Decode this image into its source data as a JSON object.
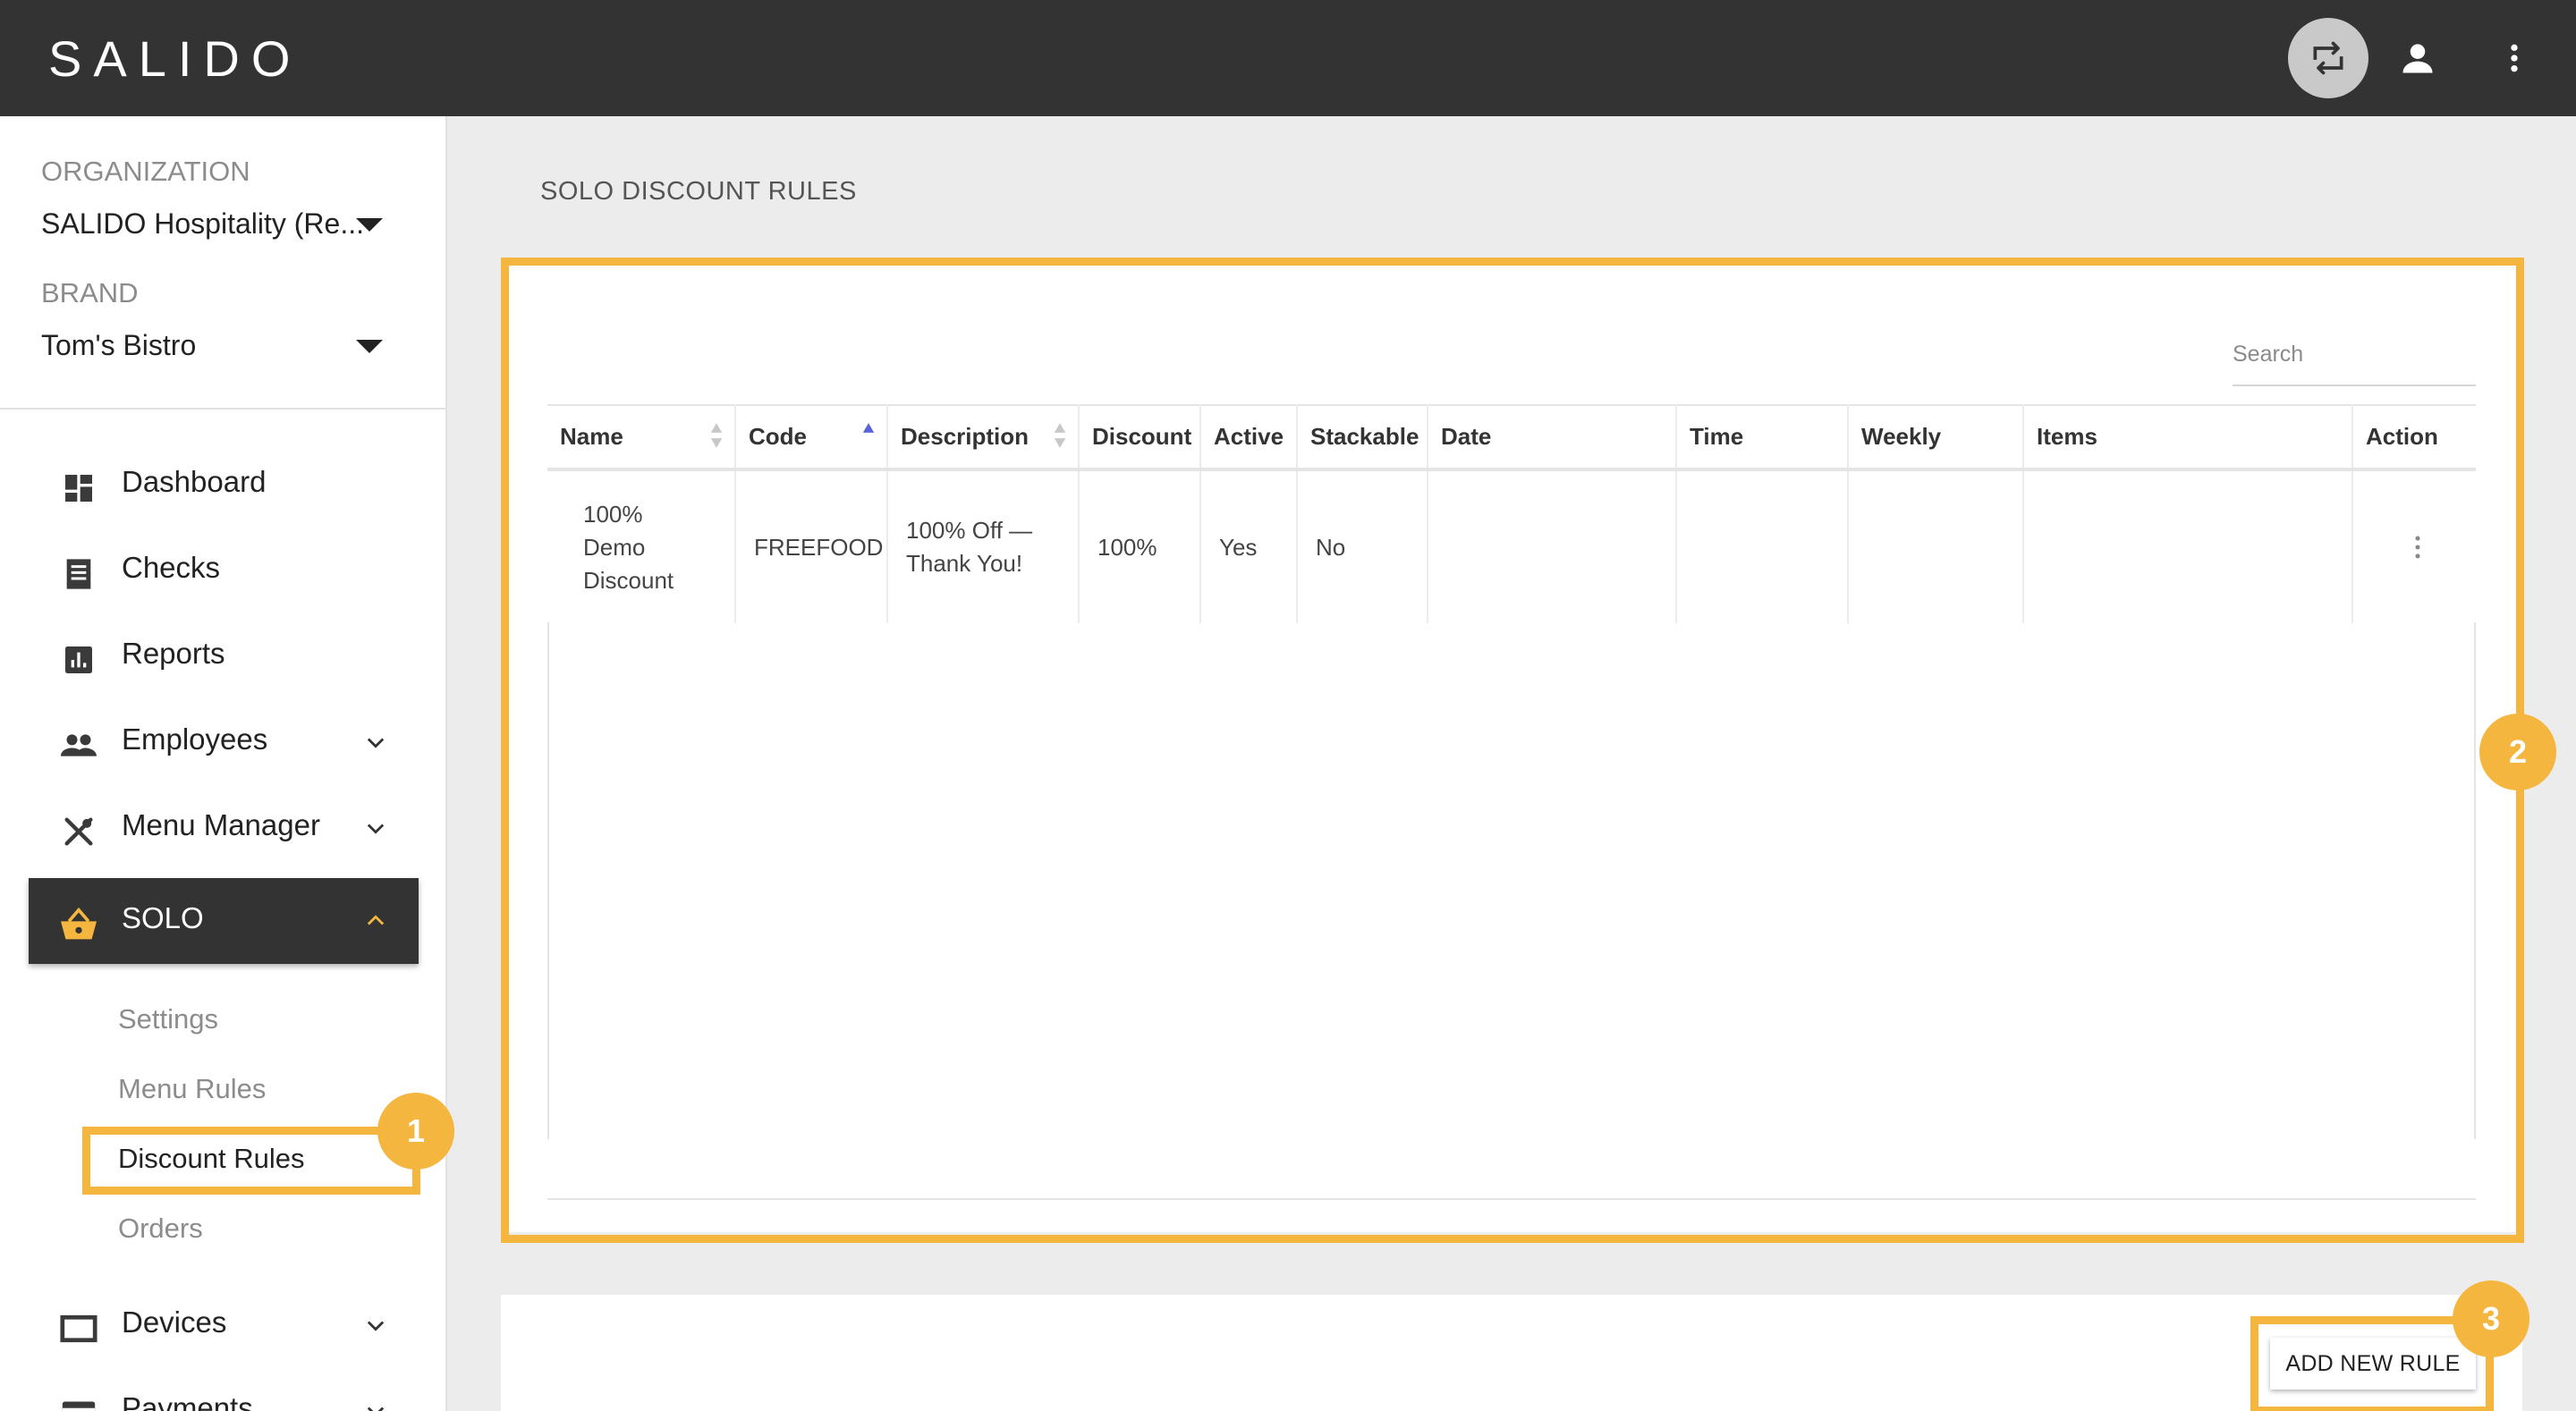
{
  "app": {
    "logo": "SALIDO"
  },
  "topbar": {
    "icons": [
      "swap-icon",
      "account-icon",
      "more-vert-icon"
    ]
  },
  "sidebar": {
    "org_label": "ORGANIZATION",
    "org_value": "SALIDO Hospitality (Re...",
    "brand_label": "BRAND",
    "brand_value": "Tom's Bistro",
    "nav": [
      {
        "label": "Dashboard",
        "icon": "dashboard-icon"
      },
      {
        "label": "Checks",
        "icon": "receipt-icon"
      },
      {
        "label": "Reports",
        "icon": "bar-chart-icon"
      },
      {
        "label": "Employees",
        "icon": "people-icon",
        "expandable": true
      },
      {
        "label": "Menu Manager",
        "icon": "utensils-icon",
        "expandable": true
      },
      {
        "label": "SOLO",
        "icon": "basket-icon",
        "expanded": true,
        "active": true
      },
      {
        "label": "Devices",
        "icon": "monitor-icon",
        "expandable": true
      },
      {
        "label": "Payments",
        "icon": "card-icon",
        "expandable": true
      }
    ],
    "solo_sub": [
      "Settings",
      "Menu Rules",
      "Discount Rules",
      "Orders"
    ],
    "current_sub": "Discount Rules"
  },
  "main": {
    "page_title": "SOLO DISCOUNT RULES",
    "search_placeholder": "Search",
    "columns": [
      "Name",
      "Code",
      "Description",
      "Discount",
      "Active",
      "Stackable",
      "Date",
      "Time",
      "Weekly",
      "Items",
      "Action"
    ],
    "sorted_column": "Code",
    "rows": [
      {
        "name": "100% Demo Discount",
        "code": "FREEFOOD",
        "description": "100% Off — Thank You!",
        "discount": "100%",
        "active": "Yes",
        "stackable": "No",
        "date": "",
        "time": "",
        "weekly": "",
        "items": ""
      }
    ],
    "add_button": "ADD NEW RULE"
  },
  "annotations": {
    "badges": [
      "1",
      "2",
      "3"
    ]
  },
  "colors": {
    "topbar": "#333333",
    "highlight": "#f4b63f",
    "accent_icon": "#f4b63f",
    "background": "#ececec"
  }
}
